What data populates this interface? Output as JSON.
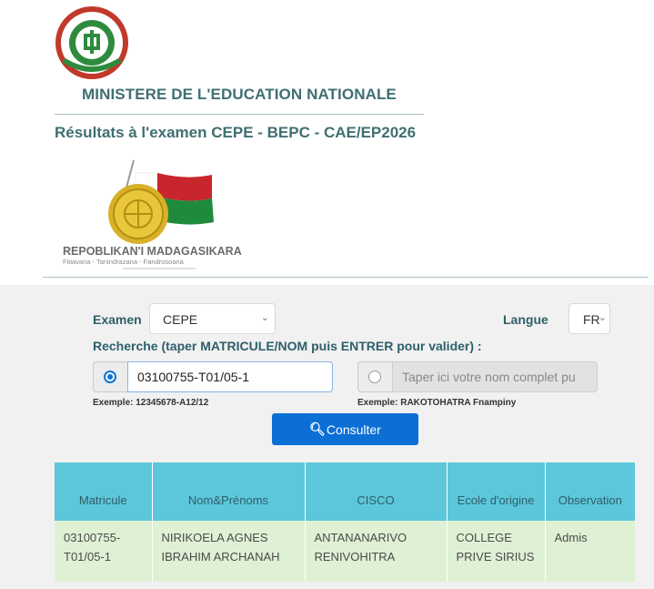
{
  "header": {
    "logo_icon": "ministry-seal-icon",
    "ministry_title": "MINISTERE DE L'EDUCATION NATIONALE",
    "results_title": "Résultats à l'examen CEPE - BEPC - CAE/EP2026",
    "emblem_icon": "repoblika-madagasikara-emblem-icon",
    "emblem_text": "REPOBLIKAN'I MADAGASIKARA",
    "emblem_motto": "Fitiavana - Tanindrazana - Fandrosoana"
  },
  "form": {
    "exam_label": "Examen",
    "exam_value": "CEPE",
    "language_label": "Langue",
    "language_value": "FR",
    "search_label": "Recherche (taper MATRICULE/NOM puis ENTRER pour valider) :",
    "matricule_value": "03100755-T01/05-1",
    "matricule_example": "Exemple: 12345678-A12/12",
    "name_placeholder": "Taper ici votre nom complet pu",
    "name_example": "Exemple: RAKOTOHATRA Fnampiny",
    "consult_icon": "search-icon",
    "consult_label": "Consulter"
  },
  "table": {
    "headers": [
      "Matricule",
      "Nom&Prénoms",
      "CISCO",
      "Ecole d'origine",
      "Observation"
    ],
    "rows": [
      {
        "matricule": "03100755-T01/05-1",
        "nom": "NIRIKOELA AGNES IBRAHIM ARCHANAH",
        "cisco": "ANTANANARIVO RENIVOHITRA",
        "ecole": "COLLEGE PRIVE SIRIUS",
        "observation": "Admis"
      }
    ]
  },
  "colors": {
    "title_teal": "#3f6f72",
    "button_blue": "#0b6fd6",
    "table_header": "#5cc7da",
    "table_row": "#dff1d4"
  }
}
